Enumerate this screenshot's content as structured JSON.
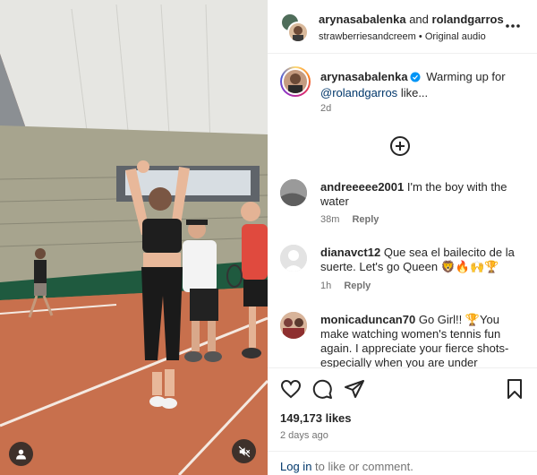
{
  "header": {
    "author_username": "arynasabalenka",
    "and_text": "and",
    "collab_username": "rolandgarros",
    "audio_user": "strawberriesandcreem",
    "audio_separator": "•",
    "audio_label": "Original audio"
  },
  "caption": {
    "username": "arynasabalenka",
    "text_before": "Warming up for",
    "mention": "@rolandgarros",
    "text_after": "like...",
    "time": "2d"
  },
  "comments": [
    {
      "username": "andreeeee2001",
      "text": "I'm the boy with the water",
      "time": "38m",
      "reply_label": "Reply"
    },
    {
      "username": "dianavct12",
      "text": "Que sea el bailecito de la suerte. Let's go Queen 🦁🔥🙌🏆",
      "time": "1h",
      "reply_label": "Reply"
    },
    {
      "username": "monicaduncan70",
      "text": "Go Girl!! 🏆You make watching women's tennis fun again. I appreciate your fierce shots- especially when you are under pressure!",
      "time": "",
      "reply_label": ""
    }
  ],
  "stats": {
    "likes": "149,173 likes",
    "posted_ago": "2 days ago"
  },
  "login_bar": {
    "link": "Log in",
    "text": "to like or comment."
  },
  "icons": {
    "more": "more-options-icon",
    "add": "add-comment-icon",
    "like": "heart-icon",
    "comment": "comment-icon",
    "share": "share-icon",
    "save": "bookmark-icon",
    "user_tag": "user-tag-icon",
    "mute": "mute-icon",
    "verified": "verified-badge-icon"
  },
  "colors": {
    "link": "#00376b",
    "secondary_text": "#737373",
    "verified": "#0095f6",
    "clay_court": "#c8704d"
  }
}
